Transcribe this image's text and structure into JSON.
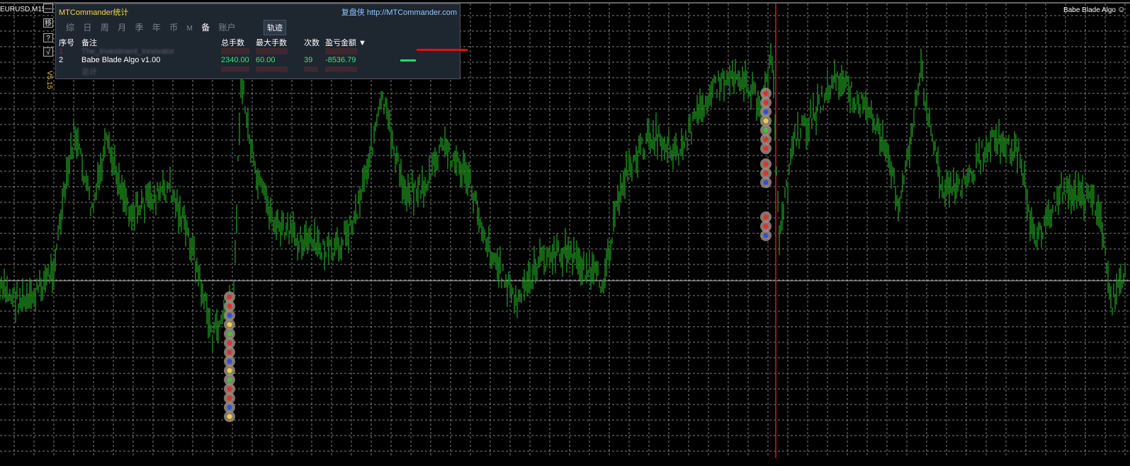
{
  "chart": {
    "symbol": "EURUSD,M15",
    "ea_label": "Babe Blade Algo",
    "smile_icon": "smiley-face-icon",
    "colors": {
      "candles": "#1f9a1f",
      "grid": "#9aa0a6",
      "marker": "#d02020",
      "hline": "#b0b4b8"
    }
  },
  "side_buttons": [
    "移",
    "?",
    "√"
  ],
  "version": "V5.15",
  "panel": {
    "title": "MTCommander统计",
    "link": "复盘侠 http://MTCommander.com",
    "tabs": [
      "综",
      "日",
      "周",
      "月",
      "季",
      "年",
      "币",
      "M",
      "备",
      "账户"
    ],
    "active_tab": "备",
    "track_button": "轨迹",
    "headers": [
      "序号",
      "备注",
      "总手数",
      "最大手数",
      "次数",
      "盈亏金额 ▼"
    ],
    "row1": {
      "no": "1",
      "note": "The_Investment_Innovator"
    },
    "row2": {
      "no": "2",
      "note": "Babe Blade Algo v1.00",
      "total": "2340.00",
      "max": "60.00",
      "count": "39",
      "pnl": "-8536.79"
    },
    "row3": {
      "no": "",
      "note": "总计"
    }
  }
}
